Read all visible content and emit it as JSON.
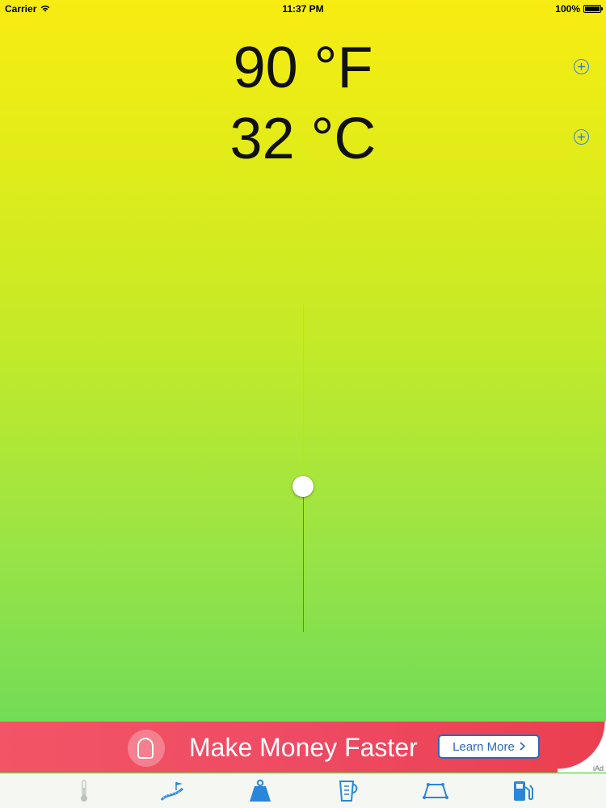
{
  "status_bar": {
    "carrier": "Carrier",
    "time": "11:37 PM",
    "battery": "100%"
  },
  "fahrenheit": "90 °F",
  "celsius": "32 °C",
  "slider": {
    "level": 0.44
  },
  "ad": {
    "headline": "Make Money Faster",
    "button_label": "Learn More",
    "badge": "iAd"
  },
  "tabs": [
    {
      "icon": "thermometer-icon",
      "active": true
    },
    {
      "icon": "road-distance-icon",
      "active": false
    },
    {
      "icon": "weight-icon",
      "active": false
    },
    {
      "icon": "measuring-cup-icon",
      "active": false
    },
    {
      "icon": "area-icon",
      "active": false
    },
    {
      "icon": "fuel-pump-icon",
      "active": false
    }
  ],
  "colors": {
    "accent": "#2a86d9",
    "ad_red": "#ef4a64"
  }
}
